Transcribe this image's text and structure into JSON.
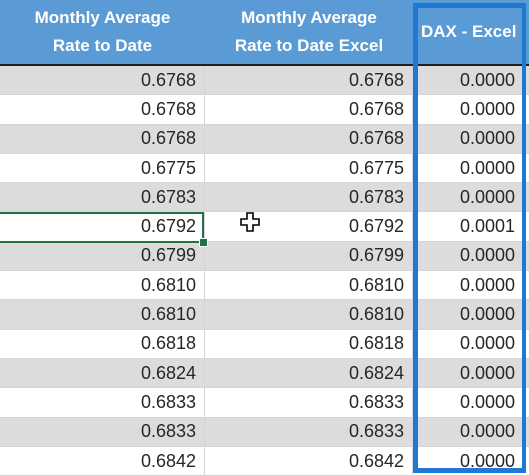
{
  "header": {
    "col1": "Monthly Average\nRate to Date",
    "col2": "Monthly Average\nRate to Date Excel",
    "col3": "DAX - Excel"
  },
  "rows": [
    {
      "rate": "0.6768",
      "rate_excel": "0.6768",
      "diff": "0.0000"
    },
    {
      "rate": "0.6768",
      "rate_excel": "0.6768",
      "diff": "0.0000"
    },
    {
      "rate": "0.6768",
      "rate_excel": "0.6768",
      "diff": "0.0000"
    },
    {
      "rate": "0.6775",
      "rate_excel": "0.6775",
      "diff": "0.0000"
    },
    {
      "rate": "0.6783",
      "rate_excel": "0.6783",
      "diff": "0.0000"
    },
    {
      "rate": "0.6792",
      "rate_excel": "0.6792",
      "diff": "0.0001"
    },
    {
      "rate": "0.6799",
      "rate_excel": "0.6799",
      "diff": "0.0000"
    },
    {
      "rate": "0.6810",
      "rate_excel": "0.6810",
      "diff": "0.0000"
    },
    {
      "rate": "0.6810",
      "rate_excel": "0.6810",
      "diff": "0.0000"
    },
    {
      "rate": "0.6818",
      "rate_excel": "0.6818",
      "diff": "0.0000"
    },
    {
      "rate": "0.6824",
      "rate_excel": "0.6824",
      "diff": "0.0000"
    },
    {
      "rate": "0.6833",
      "rate_excel": "0.6833",
      "diff": "0.0000"
    },
    {
      "rate": "0.6833",
      "rate_excel": "0.6833",
      "diff": "0.0000"
    },
    {
      "rate": "0.6842",
      "rate_excel": "0.6842",
      "diff": "0.0000"
    }
  ],
  "colors": {
    "header_bg": "#5b9bd5",
    "highlight_border": "#1f78d1",
    "selection_border": "#217346"
  },
  "cursor_icon": "cell-select-cross-icon"
}
